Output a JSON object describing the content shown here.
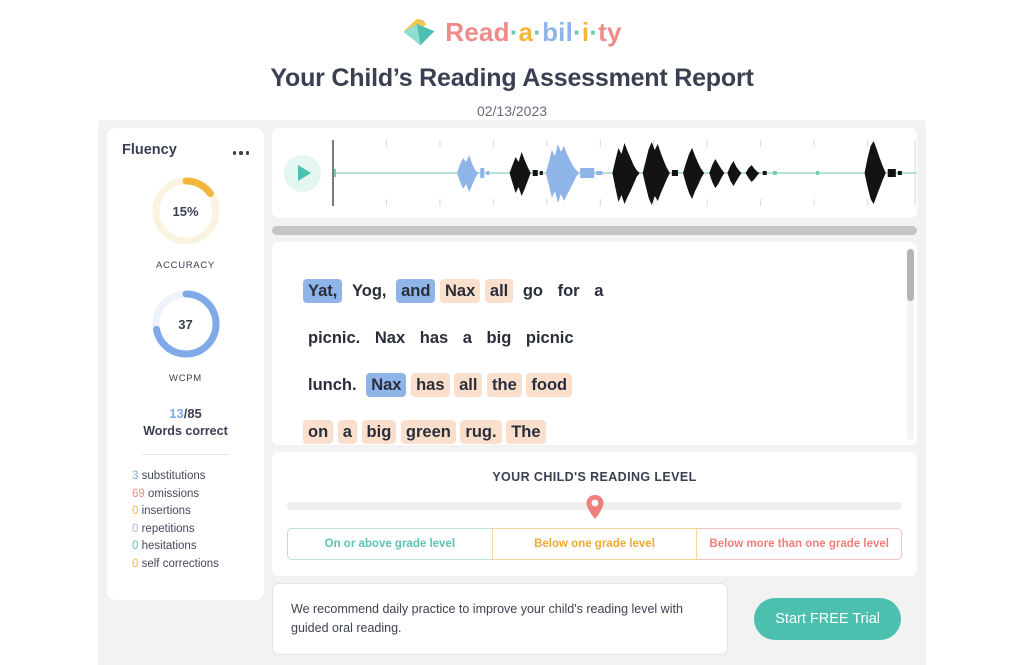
{
  "brand": {
    "logo_icon": "book-logo-icon",
    "name_parts": [
      {
        "t": "Read",
        "c": "red"
      },
      {
        "t": "·",
        "c": "teal"
      },
      {
        "t": "a",
        "c": "amber"
      },
      {
        "t": "·",
        "c": "teal"
      },
      {
        "t": "bil",
        "c": "blue"
      },
      {
        "t": "·",
        "c": "teal"
      },
      {
        "t": "i",
        "c": "amber"
      },
      {
        "t": "·",
        "c": "teal"
      },
      {
        "t": "ty",
        "c": "red"
      }
    ]
  },
  "header": {
    "title": "Your Child’s Reading Assessment Report",
    "date": "02/13/2023"
  },
  "fluency": {
    "title": "Fluency",
    "menu_icon": "more-options-icon",
    "gauges": [
      {
        "value": "15%",
        "label": "ACCURACY",
        "percent": 15,
        "color": "#f2b63c",
        "track": "#faf3e2"
      },
      {
        "value": "37",
        "label": "WCPM",
        "percent": 72,
        "color": "#7fa9e8",
        "track": "#eef2fa"
      }
    ],
    "words_correct": {
      "correct": "13",
      "separator": "/",
      "total": "85",
      "label": "Words correct"
    },
    "stats": [
      {
        "count": "3",
        "label": "substitutions",
        "color": "#7fa9e8"
      },
      {
        "count": "69",
        "label": "omissions",
        "color": "#ef8b8b"
      },
      {
        "count": "0",
        "label": "insertions",
        "color": "#f2b63c"
      },
      {
        "count": "0",
        "label": "repetitions",
        "color": "#b3aee0"
      },
      {
        "count": "0",
        "label": "hesitations",
        "color": "#5cc3b4"
      },
      {
        "count": "0",
        "label": "self corrections",
        "color": "#f2b63c"
      }
    ]
  },
  "player": {
    "play_icon": "play-button-icon",
    "waveform_colors": {
      "baseline": "#9fdcc4",
      "blue": "#8fb4e8",
      "black": "#131313"
    }
  },
  "passage": {
    "lines": [
      [
        {
          "text": "Yat,",
          "hl": "blue"
        },
        {
          "text": "Yog,",
          "hl": "none"
        },
        {
          "text": "and",
          "hl": "blue"
        },
        {
          "text": "Nax",
          "hl": "peach"
        },
        {
          "text": "all",
          "hl": "peach"
        },
        {
          "text": "go",
          "hl": "none"
        },
        {
          "text": "for",
          "hl": "none"
        },
        {
          "text": "a",
          "hl": "none"
        }
      ],
      [
        {
          "text": "picnic.",
          "hl": "none"
        },
        {
          "text": "Nax",
          "hl": "none"
        },
        {
          "text": "has",
          "hl": "none"
        },
        {
          "text": "a",
          "hl": "none"
        },
        {
          "text": "big",
          "hl": "none"
        },
        {
          "text": "picnic",
          "hl": "none"
        }
      ],
      [
        {
          "text": "lunch.",
          "hl": "none"
        },
        {
          "text": "Nax",
          "hl": "blue"
        },
        {
          "text": "has",
          "hl": "peach"
        },
        {
          "text": "all",
          "hl": "peach"
        },
        {
          "text": "the",
          "hl": "peach"
        },
        {
          "text": "food",
          "hl": "peach"
        }
      ],
      [
        {
          "text": "on",
          "hl": "peach"
        },
        {
          "text": "a",
          "hl": "peach"
        },
        {
          "text": "big",
          "hl": "peach"
        },
        {
          "text": "green",
          "hl": "peach"
        },
        {
          "text": "rug.",
          "hl": "peach"
        },
        {
          "text": "The",
          "hl": "peach"
        }
      ]
    ]
  },
  "reading_level": {
    "title": "YOUR CHILD'S READING LEVEL",
    "marker_icon": "location-pin-icon",
    "marker_position_percent": 50,
    "options": [
      {
        "label": "On or above grade level"
      },
      {
        "label": "Below one grade level"
      },
      {
        "label": "Below more than one grade level"
      }
    ]
  },
  "recommendation": {
    "text": "We recommend daily practice to improve your child's reading level with guided oral reading.",
    "cta_label": "Start FREE Trial"
  }
}
